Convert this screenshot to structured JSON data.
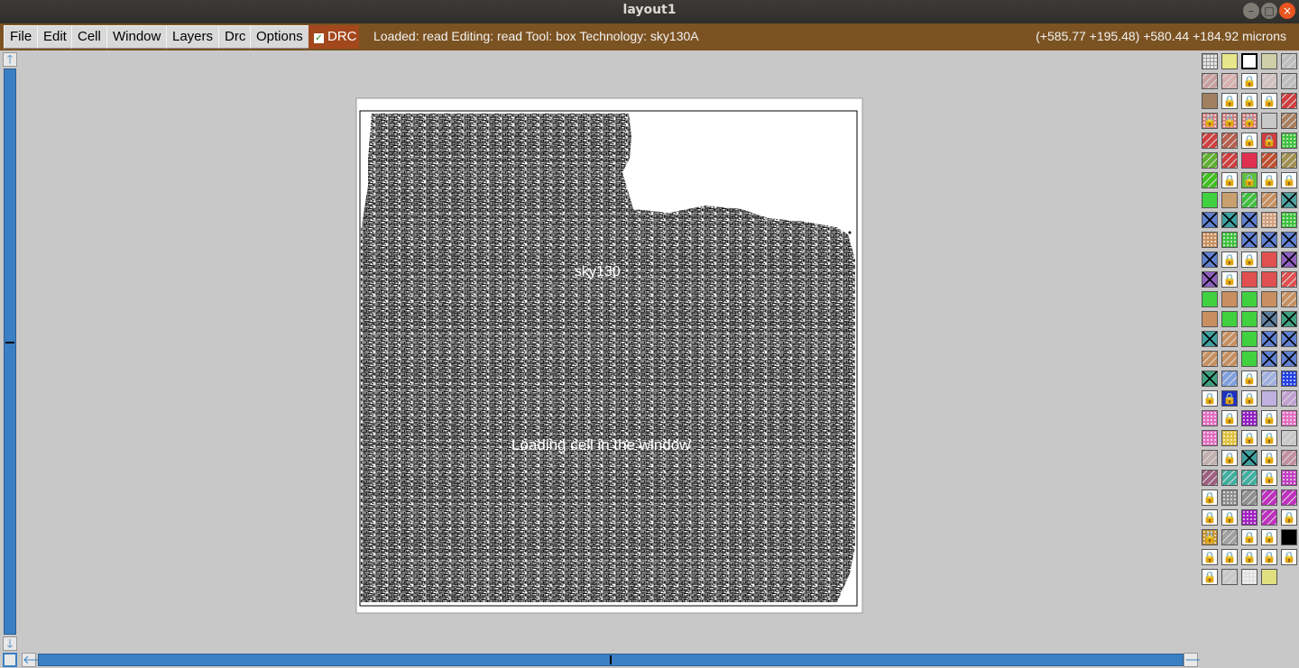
{
  "window": {
    "title": "layout1"
  },
  "menus": [
    {
      "id": "file",
      "label": "File"
    },
    {
      "id": "edit",
      "label": "Edit"
    },
    {
      "id": "cell",
      "label": "Cell"
    },
    {
      "id": "window",
      "label": "Window"
    },
    {
      "id": "layers",
      "label": "Layers"
    },
    {
      "id": "drc",
      "label": "Drc"
    },
    {
      "id": "options",
      "label": "Options"
    }
  ],
  "drc_toggle": {
    "label": "DRC",
    "checked": true
  },
  "status": {
    "text": "Loaded: read Editing: read Tool: box  Technology: sky130A",
    "coords": "(+585.77 +195.48) +580.44 +184.92 microns"
  },
  "canvas": {
    "label_top": "sky130",
    "label_middle": "Loading cell in the window"
  },
  "colors": {
    "menubar": "#7b5221",
    "drc_toggle": "#a3471d",
    "scrollbar": "#3a7fc4",
    "canvas_bg": "#c8c8c8"
  },
  "icons": [
    "scroll-up-icon",
    "scroll-down-icon",
    "scroll-left-icon",
    "scroll-right-icon",
    "zoom-box-icon",
    "lock-icon"
  ],
  "palette": {
    "columns": 5,
    "swatches": [
      {
        "c": "#e8e8e8",
        "p": "grid",
        "l": false
      },
      {
        "c": "#e6e68a",
        "p": "solid",
        "l": false
      },
      {
        "c": "#ffffff",
        "p": "box",
        "l": false
      },
      {
        "c": "#cfcfa8",
        "p": "solid",
        "l": false
      },
      {
        "c": "#bdbdbd",
        "p": "hatch",
        "l": false
      },
      {
        "c": "#c8a0a0",
        "p": "hatch",
        "l": false
      },
      {
        "c": "#d8b0b0",
        "p": "hatch",
        "l": false
      },
      {
        "c": "#ffffff",
        "p": "solid",
        "l": true
      },
      {
        "c": "#d0c0c0",
        "p": "hatch",
        "l": false
      },
      {
        "c": "#bdbdbd",
        "p": "hatch",
        "l": false
      },
      {
        "c": "#a08060",
        "p": "solid",
        "l": false
      },
      {
        "c": "#ffffff",
        "p": "solid",
        "l": true
      },
      {
        "c": "#ffffff",
        "p": "solid",
        "l": true
      },
      {
        "c": "#ffffff",
        "p": "solid",
        "l": true
      },
      {
        "c": "#d04040",
        "p": "hatch",
        "l": false
      },
      {
        "c": "#d08080",
        "p": "dots",
        "l": true
      },
      {
        "c": "#d08080",
        "p": "dots",
        "l": true
      },
      {
        "c": "#d08080",
        "p": "dots",
        "l": true
      },
      {
        "c": "#c8c8c8",
        "p": "solid",
        "l": false
      },
      {
        "c": "#a88060",
        "p": "hatch",
        "l": false
      },
      {
        "c": "#d04040",
        "p": "hatch",
        "l": false
      },
      {
        "c": "#b86050",
        "p": "hatch",
        "l": false
      },
      {
        "c": "#ffffff",
        "p": "solid",
        "l": true
      },
      {
        "c": "#d04040",
        "p": "solid",
        "l": true
      },
      {
        "c": "#40c040",
        "p": "dots",
        "l": false
      },
      {
        "c": "#60b030",
        "p": "hatch",
        "l": false
      },
      {
        "c": "#d04040",
        "p": "hatch",
        "l": false
      },
      {
        "c": "#e03050",
        "p": "solid",
        "l": false
      },
      {
        "c": "#c05030",
        "p": "hatch",
        "l": false
      },
      {
        "c": "#a09050",
        "p": "hatch",
        "l": false
      },
      {
        "c": "#40c020",
        "p": "hatch",
        "l": false
      },
      {
        "c": "#ffffff",
        "p": "solid",
        "l": true
      },
      {
        "c": "#60c040",
        "p": "solid",
        "l": true
      },
      {
        "c": "#ffffff",
        "p": "solid",
        "l": true
      },
      {
        "c": "#ffffff",
        "p": "solid",
        "l": true
      },
      {
        "c": "#40d040",
        "p": "solid",
        "l": false
      },
      {
        "c": "#c8a070",
        "p": "solid",
        "l": false
      },
      {
        "c": "#40c040",
        "p": "hatch",
        "l": false
      },
      {
        "c": "#c89060",
        "p": "hatch",
        "l": false
      },
      {
        "c": "#50a0a0",
        "p": "cross",
        "l": false
      },
      {
        "c": "#6080d0",
        "p": "cross",
        "l": false
      },
      {
        "c": "#40a0a0",
        "p": "cross",
        "l": false
      },
      {
        "c": "#6080d0",
        "p": "cross",
        "l": false
      },
      {
        "c": "#d0a080",
        "p": "dots",
        "l": false
      },
      {
        "c": "#40c040",
        "p": "dots",
        "l": false
      },
      {
        "c": "#c89060",
        "p": "dots",
        "l": false
      },
      {
        "c": "#40c040",
        "p": "dots",
        "l": false
      },
      {
        "c": "#6080d0",
        "p": "cross",
        "l": false
      },
      {
        "c": "#6080d0",
        "p": "cross",
        "l": false
      },
      {
        "c": "#6080d0",
        "p": "cross",
        "l": false
      },
      {
        "c": "#6080d0",
        "p": "cross",
        "l": false
      },
      {
        "c": "#ffffff",
        "p": "solid",
        "l": true
      },
      {
        "c": "#ffffff",
        "p": "solid",
        "l": true
      },
      {
        "c": "#e05050",
        "p": "solid",
        "l": false
      },
      {
        "c": "#9060c0",
        "p": "cross",
        "l": false
      },
      {
        "c": "#9060c0",
        "p": "cross",
        "l": false
      },
      {
        "c": "#ffffff",
        "p": "solid",
        "l": true
      },
      {
        "c": "#e05050",
        "p": "solid",
        "l": false
      },
      {
        "c": "#e05050",
        "p": "solid",
        "l": false
      },
      {
        "c": "#e05050",
        "p": "hatch",
        "l": false
      },
      {
        "c": "#40d040",
        "p": "solid",
        "l": false
      },
      {
        "c": "#c89060",
        "p": "solid",
        "l": false
      },
      {
        "c": "#40d040",
        "p": "solid",
        "l": false
      },
      {
        "c": "#c89060",
        "p": "solid",
        "l": false
      },
      {
        "c": "#c89060",
        "p": "hatch",
        "l": false
      },
      {
        "c": "#c89060",
        "p": "solid",
        "l": false
      },
      {
        "c": "#40d040",
        "p": "solid",
        "l": false
      },
      {
        "c": "#40d040",
        "p": "solid",
        "l": false
      },
      {
        "c": "#6080a0",
        "p": "cross",
        "l": false
      },
      {
        "c": "#40a080",
        "p": "cross",
        "l": false
      },
      {
        "c": "#40a0a0",
        "p": "cross",
        "l": false
      },
      {
        "c": "#c89060",
        "p": "hatch",
        "l": false
      },
      {
        "c": "#40d040",
        "p": "solid",
        "l": false
      },
      {
        "c": "#6080d0",
        "p": "cross",
        "l": false
      },
      {
        "c": "#6080d0",
        "p": "cross",
        "l": false
      },
      {
        "c": "#c89060",
        "p": "hatch",
        "l": false
      },
      {
        "c": "#c89060",
        "p": "hatch",
        "l": false
      },
      {
        "c": "#40d040",
        "p": "solid",
        "l": false
      },
      {
        "c": "#6080d0",
        "p": "cross",
        "l": false
      },
      {
        "c": "#6080d0",
        "p": "cross",
        "l": false
      },
      {
        "c": "#40a080",
        "p": "cross",
        "l": false
      },
      {
        "c": "#80a0e0",
        "p": "hatch",
        "l": false
      },
      {
        "c": "#ffffff",
        "p": "solid",
        "l": true
      },
      {
        "c": "#a0b0e0",
        "p": "hatch",
        "l": false
      },
      {
        "c": "#2040e0",
        "p": "dots",
        "l": false
      },
      {
        "c": "#ffffff",
        "p": "solid",
        "l": true
      },
      {
        "c": "#2030c0",
        "p": "solid",
        "l": true
      },
      {
        "c": "#ffffff",
        "p": "solid",
        "l": true
      },
      {
        "c": "#c0b0e0",
        "p": "solid",
        "l": false
      },
      {
        "c": "#c0a0d0",
        "p": "hatch",
        "l": false
      },
      {
        "c": "#e070c0",
        "p": "dots",
        "l": false
      },
      {
        "c": "#ffffff",
        "p": "solid",
        "l": true
      },
      {
        "c": "#9020c0",
        "p": "dots",
        "l": false
      },
      {
        "c": "#ffffff",
        "p": "solid",
        "l": true
      },
      {
        "c": "#e070c0",
        "p": "dots",
        "l": false
      },
      {
        "c": "#e070c0",
        "p": "dots",
        "l": false
      },
      {
        "c": "#e0c040",
        "p": "dots",
        "l": false
      },
      {
        "c": "#ffffff",
        "p": "solid",
        "l": true
      },
      {
        "c": "#ffffff",
        "p": "solid",
        "l": true
      },
      {
        "c": "#c8c8c8",
        "p": "hatch",
        "l": false
      },
      {
        "c": "#c0b0b0",
        "p": "hatch",
        "l": false
      },
      {
        "c": "#ffffff",
        "p": "solid",
        "l": true
      },
      {
        "c": "#40a0a0",
        "p": "cross",
        "l": false
      },
      {
        "c": "#ffffff",
        "p": "solid",
        "l": true
      },
      {
        "c": "#c090a0",
        "p": "hatch",
        "l": false
      },
      {
        "c": "#a06080",
        "p": "hatch",
        "l": false
      },
      {
        "c": "#40b0a0",
        "p": "hatch",
        "l": false
      },
      {
        "c": "#40b0a0",
        "p": "hatch",
        "l": false
      },
      {
        "c": "#ffffff",
        "p": "solid",
        "l": true
      },
      {
        "c": "#c040c0",
        "p": "dots",
        "l": false
      },
      {
        "c": "#ffffff",
        "p": "solid",
        "l": true
      },
      {
        "c": "#909090",
        "p": "dots",
        "l": false
      },
      {
        "c": "#909090",
        "p": "hatch",
        "l": false
      },
      {
        "c": "#c030c0",
        "p": "hatch",
        "l": false
      },
      {
        "c": "#c030c0",
        "p": "hatch",
        "l": false
      },
      {
        "c": "#ffffff",
        "p": "solid",
        "l": true
      },
      {
        "c": "#ffffff",
        "p": "solid",
        "l": true
      },
      {
        "c": "#a020c0",
        "p": "dots",
        "l": false
      },
      {
        "c": "#c030c0",
        "p": "hatch",
        "l": false
      },
      {
        "c": "#ffffff",
        "p": "solid",
        "l": true
      },
      {
        "c": "#c09030",
        "p": "dots",
        "l": true
      },
      {
        "c": "#a0a0a0",
        "p": "hatch",
        "l": false
      },
      {
        "c": "#ffffff",
        "p": "solid",
        "l": true
      },
      {
        "c": "#ffffff",
        "p": "solid",
        "l": true
      },
      {
        "c": "#000000",
        "p": "solid",
        "l": false
      },
      {
        "c": "#ffffff",
        "p": "solid",
        "l": true
      },
      {
        "c": "#ffffff",
        "p": "solid",
        "l": true
      },
      {
        "c": "#ffffff",
        "p": "solid",
        "l": true
      },
      {
        "c": "#ffffff",
        "p": "solid",
        "l": true
      },
      {
        "c": "#ffffff",
        "p": "solid",
        "l": true
      },
      {
        "c": "#ffffff",
        "p": "solid",
        "l": true
      },
      {
        "c": "#c8c8c8",
        "p": "hatch",
        "l": false
      },
      {
        "c": "#e0e0e0",
        "p": "dots",
        "l": false
      },
      {
        "c": "#e0e080",
        "p": "solid",
        "l": false
      }
    ]
  }
}
